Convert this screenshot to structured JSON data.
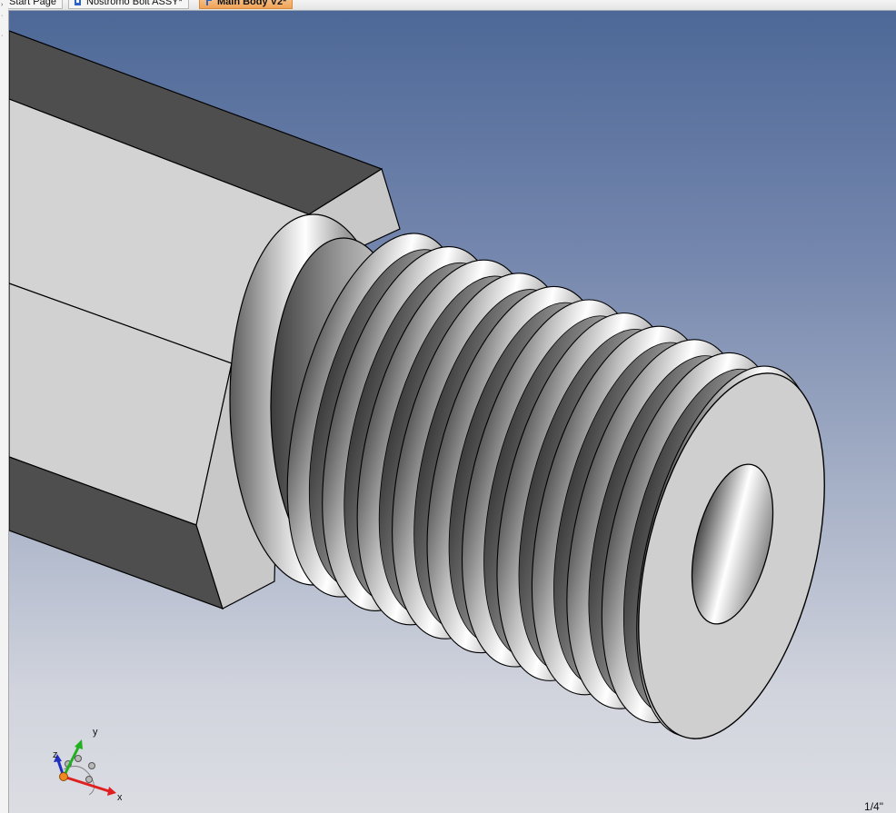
{
  "tabs": [
    {
      "label": "Start Page",
      "icon": "document-icon",
      "active": false
    },
    {
      "label": "Nostromo Bolt ASSY*",
      "icon": "assembly-icon",
      "active": false
    },
    {
      "label": "Main Body V2*",
      "icon": "part-icon",
      "active": true
    }
  ],
  "triad": {
    "x_label": "x",
    "y_label": "y",
    "z_label": "z"
  },
  "scale_label": "1/4\"",
  "colors": {
    "tab_active": "#f0a256",
    "background_top": "#4d6897",
    "background_bottom": "#dcdde3",
    "axis_x": "#e02020",
    "axis_y": "#20b020",
    "axis_z": "#2030c0"
  }
}
